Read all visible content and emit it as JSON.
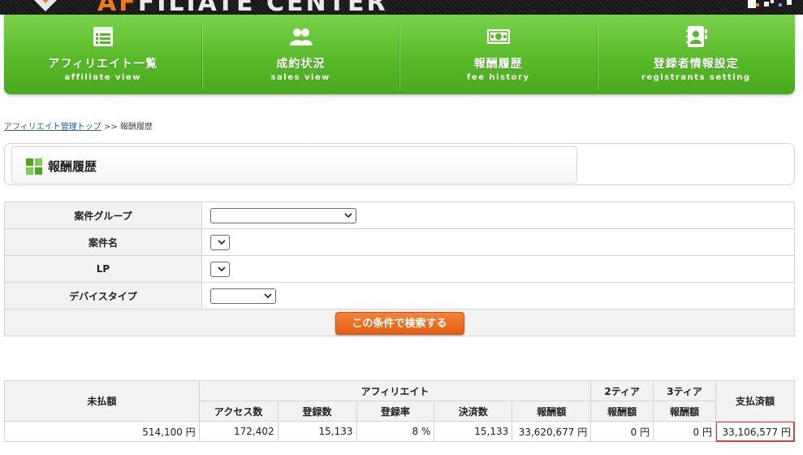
{
  "header": {
    "logo_text_accent": "AF",
    "logo_text": "FILIATE CENTER"
  },
  "nav": [
    {
      "ja": "アフィリエイト一覧",
      "en": "affiliate view",
      "icon": "list-window-icon"
    },
    {
      "ja": "成約状況",
      "en": "sales view",
      "icon": "users-icon"
    },
    {
      "ja": "報酬履歴",
      "en": "fee history",
      "icon": "money-icon"
    },
    {
      "ja": "登録者情報設定",
      "en": "registrants setting",
      "icon": "address-book-icon"
    }
  ],
  "breadcrumb": {
    "link": "アフィリエイト管理トップ",
    "separator": ">>",
    "current": "報酬履歴"
  },
  "page_title": "報酬履歴",
  "form": {
    "group_label": "案件グループ",
    "name_label": "案件名",
    "lp_label": "LP",
    "device_label": "デバイスタイプ",
    "group_value": "",
    "name_value": "",
    "lp_value": "",
    "device_value": "",
    "search_button": "この条件で検索する"
  },
  "results": {
    "headers": {
      "unpaid": "未払額",
      "affiliate": "アフィリエイト",
      "tier2_a": "2ティア",
      "tier2_b": "報酬額",
      "tier3_a": "3ティア",
      "tier3_b": "報酬額",
      "paid": "支払済額",
      "access": "アクセス数",
      "registrations": "登録数",
      "reg_rate": "登録率",
      "settlements": "決済数",
      "reward": "報酬額"
    },
    "row": {
      "unpaid": "514,100 円",
      "access": "172,402",
      "registrations": "15,133",
      "reg_rate": "8 %",
      "settlements": "15,133",
      "reward": "33,620,677 円",
      "tier2": "0 円",
      "tier3": "0 円",
      "paid": "33,106,577 円"
    }
  },
  "colors": {
    "nav_green": "#56b826",
    "button_orange": "#e35f10",
    "highlight_red": "#e23d3d",
    "link_blue": "#2a5db0"
  }
}
